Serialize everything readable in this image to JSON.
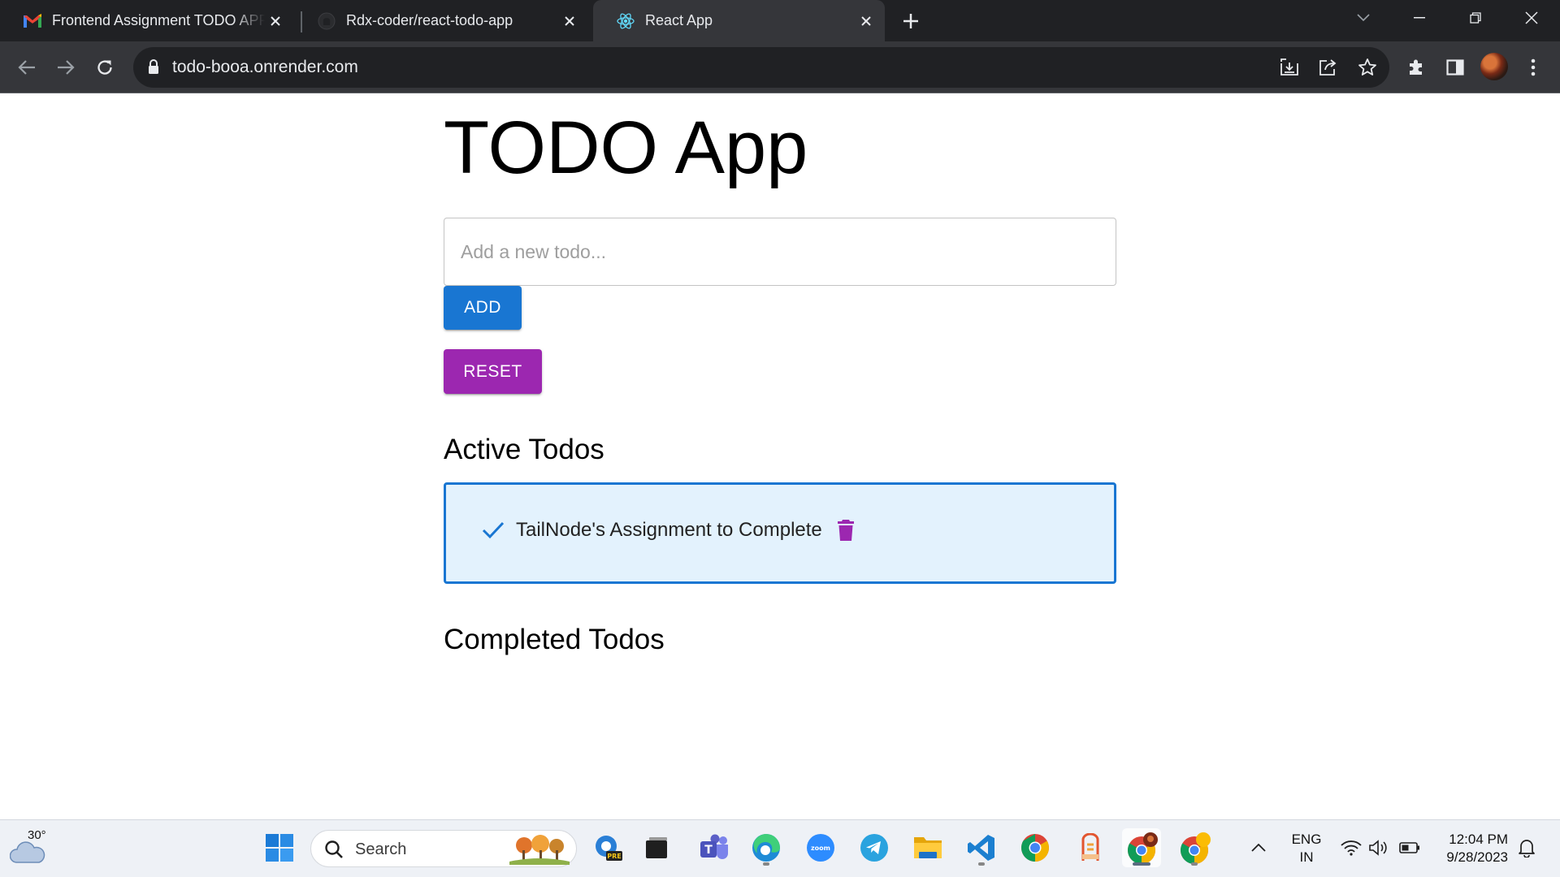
{
  "browser": {
    "tabs": [
      {
        "title": "Frontend Assignment TODO APP",
        "favicon": "gmail-icon",
        "active": false
      },
      {
        "title": "Rdx-coder/react-todo-app",
        "favicon": "github-icon",
        "active": false
      },
      {
        "title": "React App",
        "favicon": "react-icon",
        "active": true
      }
    ],
    "url": "todo-booa.onrender.com"
  },
  "app": {
    "title": "TODO App",
    "input_placeholder": "Add a new todo...",
    "add_label": "ADD",
    "reset_label": "RESET",
    "active_heading": "Active Todos",
    "completed_heading": "Completed Todos",
    "active_todos": [
      {
        "text": "TailNode's Assignment to Complete"
      }
    ],
    "completed_todos": [],
    "colors": {
      "primary": "#1976d2",
      "secondary": "#9c27b0",
      "card_bg": "#e3f2fd"
    }
  },
  "taskbar": {
    "weather_temp": "30°",
    "search_label": "Search",
    "apps": [
      "windows-start",
      "search",
      "outlook-pre",
      "task-view",
      "teams",
      "edge",
      "zoom",
      "telegram",
      "file-explorer",
      "vscode",
      "chrome",
      "app-store-s",
      "chrome-profile-1",
      "chrome-profile-2"
    ],
    "lang_line1": "ENG",
    "lang_line2": "IN",
    "time": "12:04 PM",
    "date": "9/28/2023"
  }
}
